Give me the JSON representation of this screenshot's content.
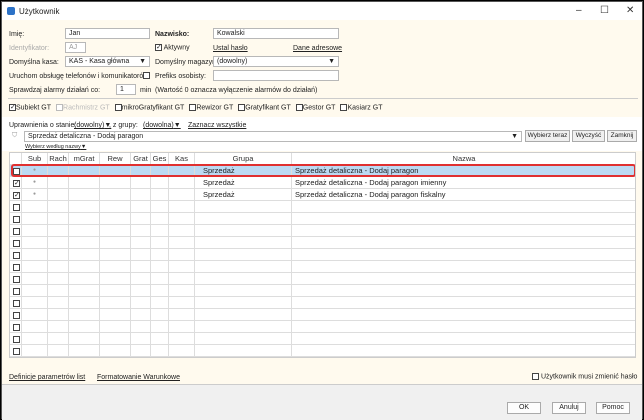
{
  "window": {
    "title": "Użytkownik",
    "icon": "app-icon"
  },
  "form": {
    "imie_label": "Imię:",
    "imie": "Jan",
    "nazwisko_label": "Nazwisko:",
    "nazwisko": "Kowalski",
    "identyfikator_label": "Identyfikator:",
    "identyfikator": "AJ",
    "aktywny_label": "Aktywny",
    "aktywny": true,
    "ustal_haslo": "Ustal hasło",
    "dane_adresowe": "Dane adresowe",
    "kasa_label": "Domyślna kasa:",
    "kasa": "KAS - Kasa główna",
    "magazyn_label": "Domyślny magazyn:",
    "magazyn": "(dowolny)",
    "telefony_label": "Uruchom obsługę telefonów i komunikatorów",
    "telefony": false,
    "prefiks_label": "Prefiks osobisty:",
    "prefiks": "",
    "alarmy_label": "Sprawdzaj alarmy działań co:",
    "alarmy": "1",
    "alarmy_unit": "min",
    "alarmy_note": "(Wartość 0 oznacza wyłączenie alarmów do działań)"
  },
  "products": [
    {
      "label": "Subiekt GT",
      "checked": true,
      "disabled": false
    },
    {
      "label": "Rachmistrz GT",
      "checked": false,
      "disabled": true
    },
    {
      "label": "mikroGratyfikant GT",
      "checked": false,
      "disabled": false
    },
    {
      "label": "Rewizor GT",
      "checked": false,
      "disabled": false
    },
    {
      "label": "Gratyfikant GT",
      "checked": false,
      "disabled": false
    },
    {
      "label": "Gestor GT",
      "checked": false,
      "disabled": false
    },
    {
      "label": "Kasiarz GT",
      "checked": false,
      "disabled": false
    }
  ],
  "filter": {
    "stan_label": "Uprawnienia o stanie:",
    "stan": "(dowolny)",
    "grupa_label": ", z grupy:",
    "grupa": "(dowolna)",
    "zaznacz": "Zaznacz wszystkie",
    "search": "Sprzedaż detaliczna - Dodaj paragon",
    "wybierz_teraz": "Wybierz teraz",
    "wyczysc": "Wyczyść",
    "zamknij": "Zamknij",
    "wybierz_wedlug": "Wybierz według nazwy"
  },
  "grid": {
    "columns": [
      "",
      "Sub",
      "Rach",
      "mGrat",
      "Rew",
      "Grat",
      "Ges",
      "Kas",
      "Grupa",
      "Nazwa"
    ],
    "rows": [
      {
        "checked": false,
        "sub": "●",
        "grupa": "Sprzedaż",
        "nazwa": "Sprzedaż detaliczna - Dodaj paragon",
        "selected": true
      },
      {
        "checked": true,
        "sub": "●",
        "grupa": "Sprzedaż",
        "nazwa": "Sprzedaż detaliczna - Dodaj paragon imienny",
        "selected": false
      },
      {
        "checked": true,
        "sub": "●",
        "grupa": "Sprzedaż",
        "nazwa": "Sprzedaż detaliczna - Dodaj paragon fiskalny",
        "selected": false
      }
    ],
    "empty_rows": 13
  },
  "bottom": {
    "definicje": "Definicje parametrów list",
    "formatowanie": "Formatowanie Warunkowe",
    "musi_zmienic": "Użytkownik musi zmienić hasło",
    "musi_zmienic_checked": false
  },
  "buttons": {
    "ok": "OK",
    "anuluj": "Anuluj",
    "pomoc": "Pomoc"
  }
}
